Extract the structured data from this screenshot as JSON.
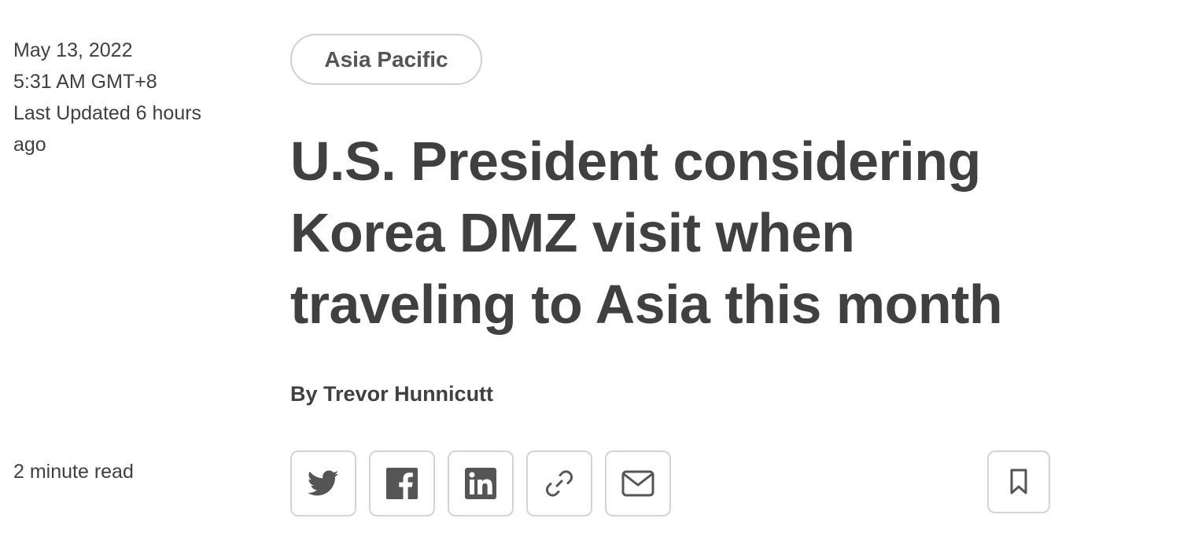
{
  "meta": {
    "date": "May 13, 2022",
    "time": "5:31 AM GMT+8",
    "updated_line1": "Last Updated 6 hours",
    "updated_line2": "ago",
    "read_time": "2 minute read"
  },
  "tag": {
    "label": "Asia Pacific"
  },
  "article": {
    "headline": "U.S. President considering Korea DMZ visit when traveling to Asia this month",
    "byline_prefix": "By ",
    "author": "Trevor Hunnicutt"
  },
  "share": {
    "icons": [
      "twitter-icon",
      "facebook-icon",
      "linkedin-icon",
      "link-icon",
      "email-icon"
    ],
    "bookmark_icon": "bookmark-icon"
  },
  "colors": {
    "text": "#404040",
    "border": "#d4d4d4",
    "icon": "#555555"
  }
}
